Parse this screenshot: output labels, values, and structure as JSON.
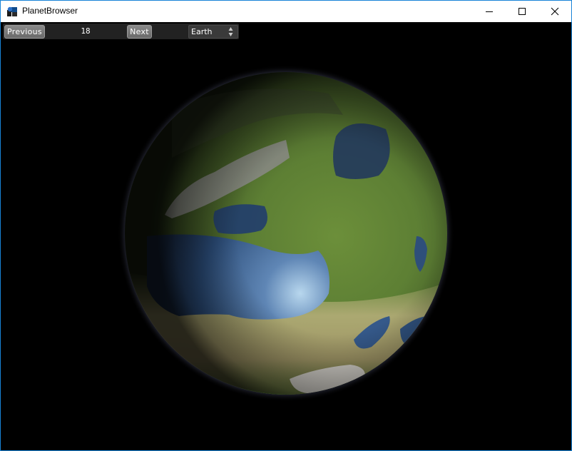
{
  "window": {
    "title": "PlanetBrowser"
  },
  "toolbar": {
    "previous_label": "Previous",
    "seed_value": "18",
    "next_label": "Next",
    "planet_selected": "Earth"
  },
  "icons": [
    "planetbrowser-app-icon",
    "minimize-icon",
    "maximize-icon",
    "close-icon",
    "spinner-arrows-icon"
  ]
}
